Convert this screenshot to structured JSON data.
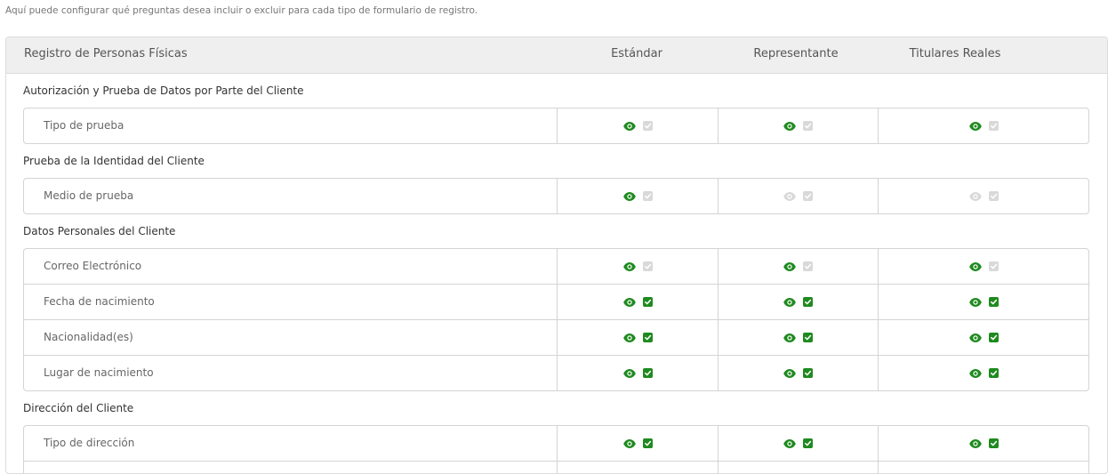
{
  "intro_text": "Aquí puede configurar qué preguntas desea incluir o excluir para cada tipo de formulario de registro.",
  "colors": {
    "active_green": "#1f8a1f",
    "inactive_gray": "#d9d9d9"
  },
  "header": {
    "title": "Registro de Personas Físicas",
    "columns": [
      "Estándar",
      "Representante",
      "Titulares Reales"
    ]
  },
  "sections": [
    {
      "title": "Autorización y Prueba de Datos por Parte del Cliente",
      "rows": [
        {
          "label": "Tipo de prueba",
          "cells": [
            {
              "visible": true,
              "required": false
            },
            {
              "visible": true,
              "required": false
            },
            {
              "visible": true,
              "required": false
            }
          ]
        }
      ]
    },
    {
      "title": "Prueba de la Identidad del Cliente",
      "rows": [
        {
          "label": "Medio de prueba",
          "cells": [
            {
              "visible": true,
              "required": false
            },
            {
              "visible": false,
              "required": false
            },
            {
              "visible": false,
              "required": false
            }
          ]
        }
      ]
    },
    {
      "title": "Datos Personales del Cliente",
      "rows": [
        {
          "label": "Correo Electrónico",
          "cells": [
            {
              "visible": true,
              "required": false
            },
            {
              "visible": true,
              "required": false
            },
            {
              "visible": true,
              "required": false
            }
          ]
        },
        {
          "label": "Fecha de nacimiento",
          "cells": [
            {
              "visible": true,
              "required": true
            },
            {
              "visible": true,
              "required": true
            },
            {
              "visible": true,
              "required": true
            }
          ]
        },
        {
          "label": "Nacionalidad(es)",
          "cells": [
            {
              "visible": true,
              "required": true
            },
            {
              "visible": true,
              "required": true
            },
            {
              "visible": true,
              "required": true
            }
          ]
        },
        {
          "label": "Lugar de nacimiento",
          "cells": [
            {
              "visible": true,
              "required": true
            },
            {
              "visible": true,
              "required": true
            },
            {
              "visible": true,
              "required": true
            }
          ]
        }
      ]
    },
    {
      "title": "Dirección del Cliente",
      "rows": [
        {
          "label": "Tipo de dirección",
          "cells": [
            {
              "visible": true,
              "required": true
            },
            {
              "visible": true,
              "required": true
            },
            {
              "visible": true,
              "required": true
            }
          ]
        },
        {
          "label": "",
          "cells": [
            {
              "visible": null,
              "required": null
            },
            {
              "visible": null,
              "required": null
            },
            {
              "visible": null,
              "required": null
            }
          ]
        }
      ]
    }
  ]
}
